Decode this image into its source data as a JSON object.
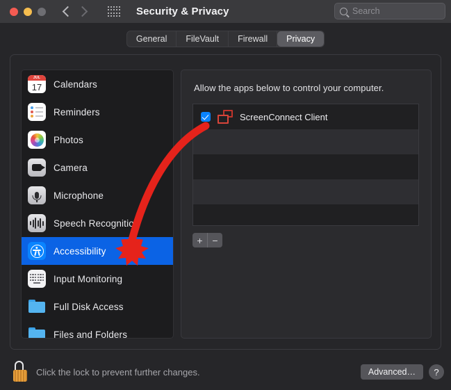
{
  "window": {
    "title": "Security & Privacy",
    "traffic_lights": [
      "close",
      "minimize",
      "zoom"
    ],
    "back_icon": "chevron-left-icon",
    "forward_icon": "chevron-right-icon",
    "grid_icon": "grid-icon"
  },
  "search": {
    "placeholder": "Search",
    "value": "",
    "icon": "search-icon"
  },
  "tabs": [
    {
      "label": "General",
      "active": false
    },
    {
      "label": "FileVault",
      "active": false
    },
    {
      "label": "Firewall",
      "active": false
    },
    {
      "label": "Privacy",
      "active": true
    }
  ],
  "sidebar": {
    "items": [
      {
        "label": "Calendars",
        "icon": "calendar-icon",
        "selected": false,
        "calendar_month": "JUL",
        "calendar_day": "17"
      },
      {
        "label": "Reminders",
        "icon": "reminders-icon",
        "selected": false
      },
      {
        "label": "Photos",
        "icon": "photos-icon",
        "selected": false
      },
      {
        "label": "Camera",
        "icon": "camera-icon",
        "selected": false
      },
      {
        "label": "Microphone",
        "icon": "microphone-icon",
        "selected": false
      },
      {
        "label": "Speech Recognition",
        "icon": "speech-icon",
        "selected": false
      },
      {
        "label": "Accessibility",
        "icon": "accessibility-icon",
        "selected": true
      },
      {
        "label": "Input Monitoring",
        "icon": "keyboard-icon",
        "selected": false
      },
      {
        "label": "Full Disk Access",
        "icon": "folder-icon",
        "selected": false
      },
      {
        "label": "Files and Folders",
        "icon": "folder-icon",
        "selected": false
      }
    ]
  },
  "main": {
    "description": "Allow the apps below to control your computer.",
    "apps": [
      {
        "name": "ScreenConnect Client",
        "checked": true,
        "icon": "screenconnect-icon"
      }
    ],
    "add_button": "+",
    "remove_button": "−"
  },
  "footer": {
    "lock_icon": "unlocked-padlock-icon",
    "lock_text": "Click the lock to prevent further changes.",
    "advanced_label": "Advanced…",
    "help_label": "?"
  },
  "annotation": {
    "arrow_color": "#e5231b",
    "target": "Accessibility"
  },
  "colors": {
    "accent_blue": "#0a84ff",
    "selection_blue": "#0b63e5",
    "titlebar": "#3a3a3d",
    "window_bg": "#262629",
    "sidebar_bg": "#1c1c1e",
    "annotation_red": "#e5231b"
  }
}
